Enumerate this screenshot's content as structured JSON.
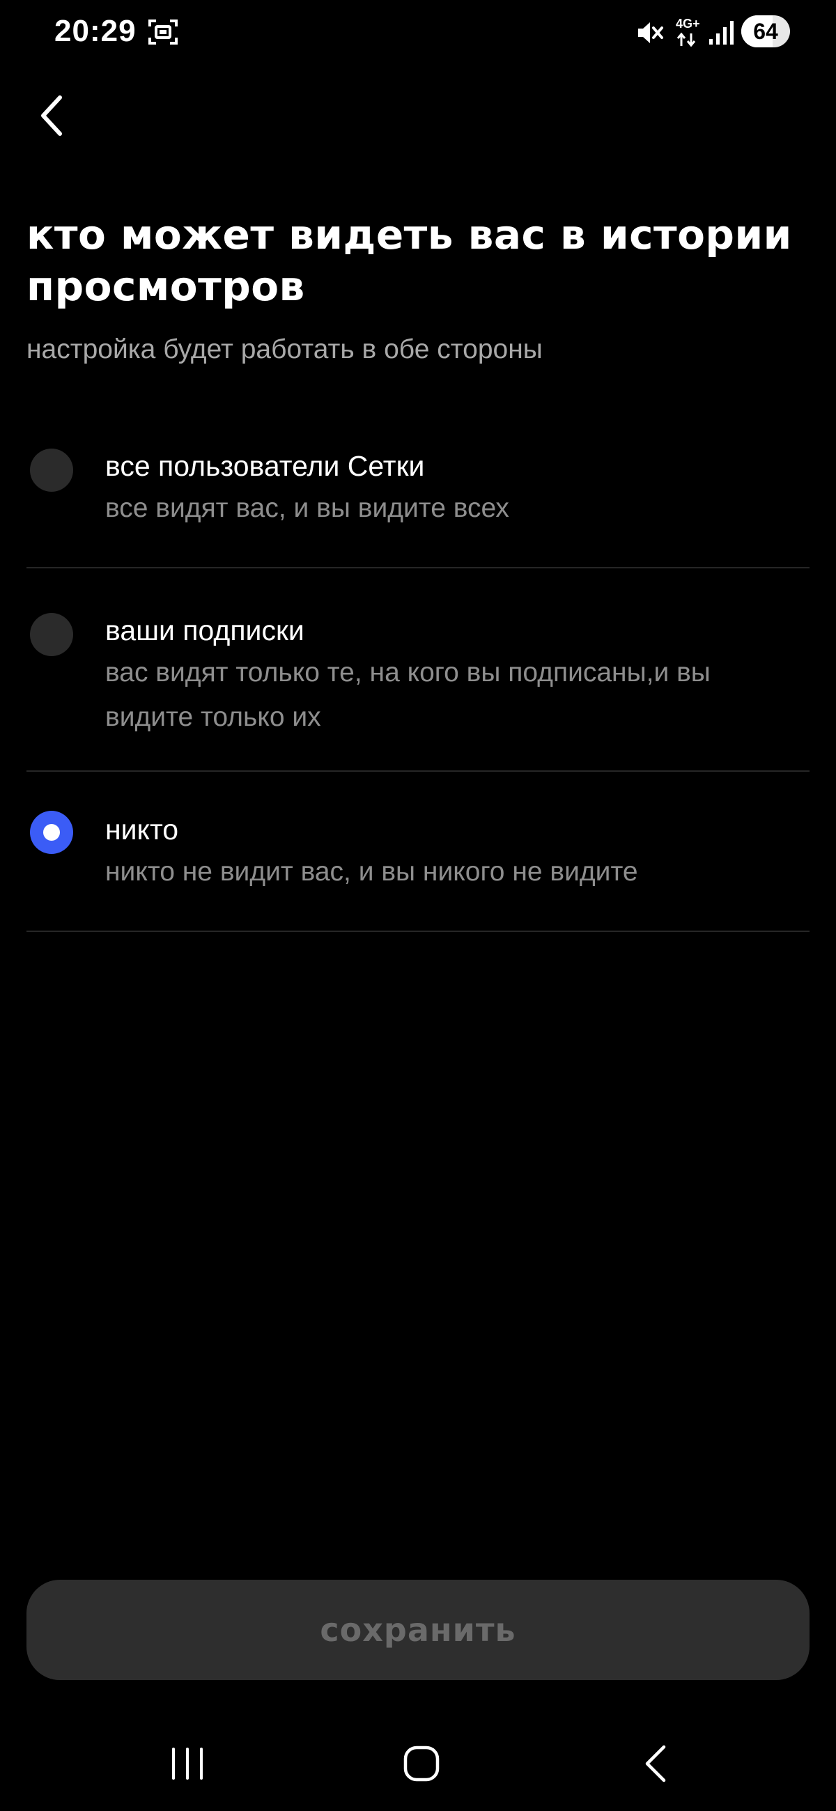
{
  "status_bar": {
    "time": "20:29",
    "network": "4G+",
    "battery": "64",
    "battery_level": 0.64,
    "icons": [
      "screenshot-icon",
      "mute-icon",
      "network-icon",
      "signal-icon"
    ]
  },
  "header": {
    "back_icon": "chevron-left-icon"
  },
  "page": {
    "title": "кто может видеть вас в истории просмотров",
    "subtitle": "настройка будет работать в обе стороны"
  },
  "options": [
    {
      "title": "все пользователи Сетки",
      "description": "все видят вас, и вы видите всех",
      "selected": false
    },
    {
      "title": "ваши подписки",
      "description": "вас видят только те, на кого вы подписаны,и вы видите только их",
      "selected": false
    },
    {
      "title": "никто",
      "description": "никто не видит вас, и вы никого не видите",
      "selected": true
    }
  ],
  "footer": {
    "save_label": "сохранить"
  },
  "nav_bar": {
    "icons": [
      "recents-icon",
      "home-icon",
      "back-icon"
    ]
  },
  "colors": {
    "background": "#000000",
    "accent": "#3b5cf6",
    "text_primary": "#ffffff",
    "text_secondary": "#8e8e8e",
    "button_bg": "#2e2e2e",
    "button_text": "#6a6a6a"
  }
}
